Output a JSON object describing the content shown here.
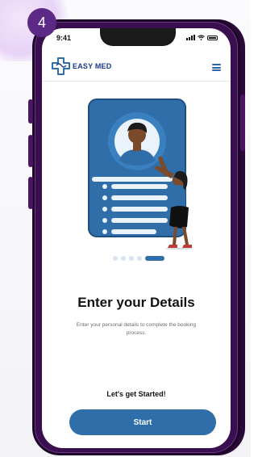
{
  "step_badge": "4",
  "status_bar": {
    "time": "9:41"
  },
  "app": {
    "brand": "EASY MED"
  },
  "carousel": {
    "total": 5,
    "active_index": 4
  },
  "onboarding": {
    "title": "Enter your Details",
    "description": "Enter your personal details to complete the booking process.",
    "cta_text": "Let's get Started!",
    "start_label": "Start"
  },
  "colors": {
    "primary": "#2f6ea8",
    "brand_text": "#1b3a8f",
    "phone_frame": "#3a0f4f",
    "badge": "#5c2a86"
  }
}
